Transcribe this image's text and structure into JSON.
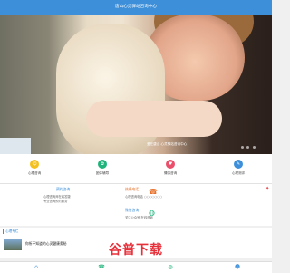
{
  "header": {
    "title": "唐山心灵驿站咨询中心"
  },
  "hero": {
    "caption": "爱在唐山 心灵驿站咨询中心"
  },
  "quick": [
    {
      "label": "心理咨询",
      "icon": "smile-icon",
      "color": "#f3c01e",
      "glyph": "☺"
    },
    {
      "label": "团体辅导",
      "icon": "group-icon",
      "color": "#21b37c",
      "glyph": "✿"
    },
    {
      "label": "情感咨询",
      "icon": "heart-icon",
      "color": "#ea4f6b",
      "glyph": "♥"
    },
    {
      "label": "心理测评",
      "icon": "test-icon",
      "color": "#3d8fd9",
      "glyph": "✎"
    }
  ],
  "services": [
    {
      "title": "预约咨询",
      "desc": "心理咨询师在线答疑\n专业咨询预约服务",
      "color": "#3d8fd9"
    },
    {
      "title": "热线电话",
      "desc": "心理咨询电话 ○○○○○○○",
      "color": "#e8722c"
    },
    {
      "title": "微信咨询",
      "desc": "关注公众号 在线咨询",
      "color": "#3d8fd9"
    }
  ],
  "news": {
    "section_title": "心理专栏",
    "item_title": "你所不知道的心灵健康奥秘"
  },
  "watermark": "谷普下载",
  "bottom_icons": [
    "home-icon",
    "phone-icon",
    "wechat-icon",
    "user-icon"
  ]
}
